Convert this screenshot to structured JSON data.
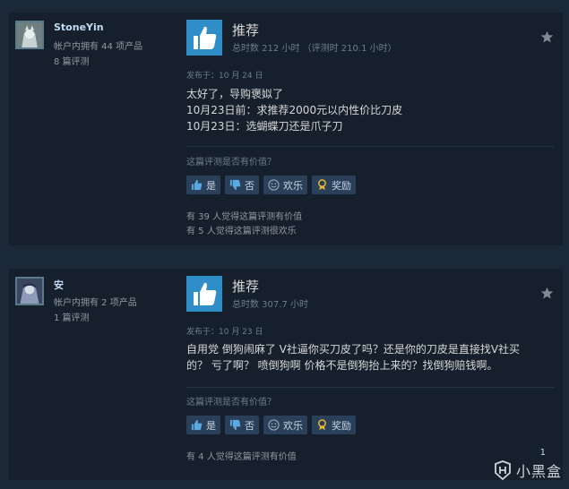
{
  "reviews": [
    {
      "author": {
        "name": "StoneYin",
        "products": "帐户内拥有 44 项产品",
        "review_count": "8 篇评测"
      },
      "verdict": "推荐",
      "hours": "总时数 212 小时 （评测时 210.1 小时）",
      "posted": "发布于：10 月 24 日",
      "body": [
        "太好了，导购褒姒了",
        "10月23日前：求推荐2000元以内性价比刀皮",
        "10月23日：选蝴蝶刀还是爪子刀"
      ],
      "helpful_question": "这篇评测是否有价值？",
      "buttons": {
        "yes": "是",
        "no": "否",
        "funny": "欢乐",
        "award": "奖励"
      },
      "helpful_lines": [
        "有 39 人觉得这篇评测有价值",
        "有 5 人觉得这篇评测很欢乐"
      ]
    },
    {
      "author": {
        "name": "安",
        "products": "帐户内拥有 2 项产品",
        "review_count": "1 篇评测"
      },
      "verdict": "推荐",
      "hours": "总时数 307.7 小时",
      "posted": "发布于：10 月 23 日",
      "body": [
        "自用党 倒狗闹麻了 V社逼你买刀皮了吗？还是你的刀皮是直接找V社买",
        "的？ 亏了啊？ 喷倒狗啊 价格不是倒狗抬上来的？找倒狗赔钱啊。"
      ],
      "helpful_question": "这篇评测是否有价值？",
      "buttons": {
        "yes": "是",
        "no": "否",
        "funny": "欢乐",
        "award": "奖励"
      },
      "helpful_lines": [
        "有 4 人觉得这篇评测有价值"
      ]
    }
  ],
  "watermark": {
    "text": "小黑盒",
    "count": "1"
  },
  "colors": {
    "background": "#1b2838",
    "card": "#16202d",
    "thumb": "#2f8ec7",
    "button": "#2a3f5a",
    "accent_name": "#c1dbf4"
  }
}
